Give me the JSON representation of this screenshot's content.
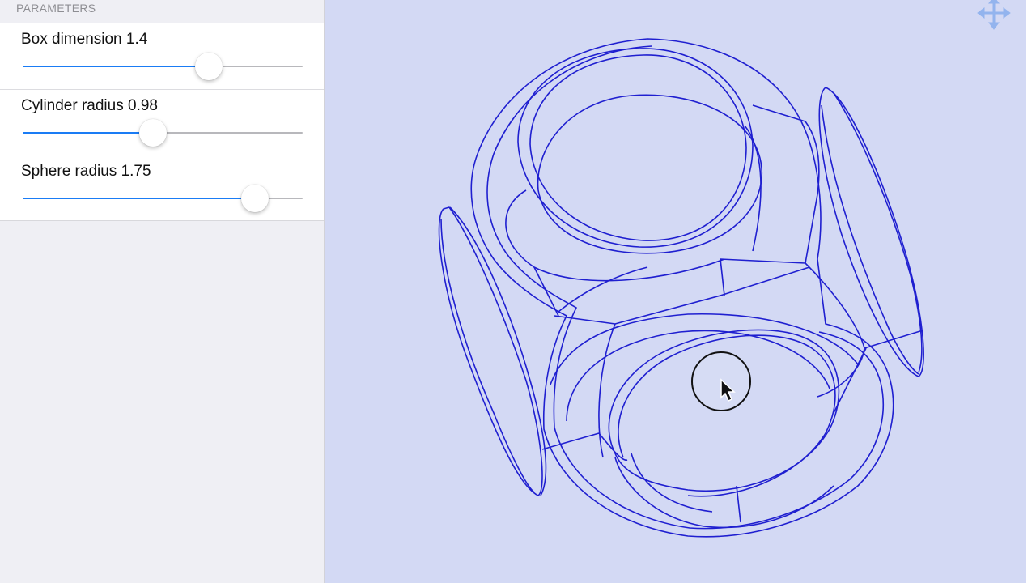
{
  "sidebar": {
    "section_header": "PARAMETERS",
    "params": [
      {
        "label": "Box dimension 1.4",
        "value_fraction": 0.665
      },
      {
        "label": "Cylinder radius 0.98",
        "value_fraction": 0.465
      },
      {
        "label": "Sphere radius 1.75",
        "value_fraction": 0.83
      }
    ]
  },
  "viewport": {
    "toolbar_icon": "move-arrows-icon",
    "model": "box-cylinder-sphere-wireframe",
    "colors": {
      "background": "#d3d9f4",
      "wire": "#1f1fd0",
      "accent": "#1a7cf5",
      "icon": "#93b4ee"
    }
  }
}
